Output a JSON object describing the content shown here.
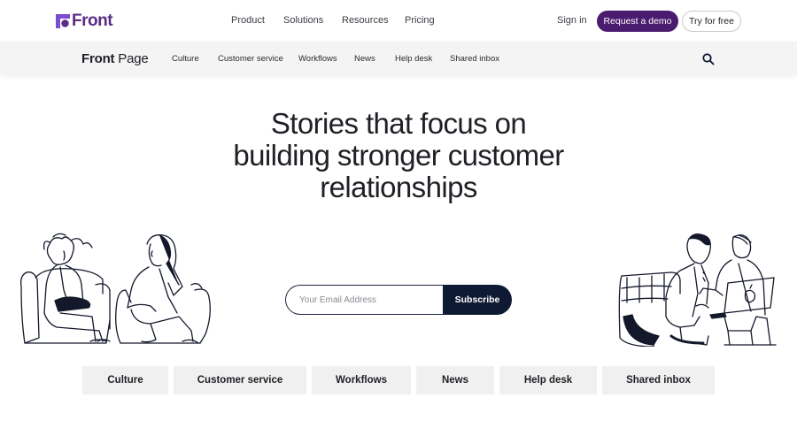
{
  "brand": {
    "name": "Front",
    "color": "#5b2b86"
  },
  "main_nav": [
    "Product",
    "Solutions",
    "Resources",
    "Pricing"
  ],
  "auth": {
    "sign_in": "Sign in",
    "demo": "Request a demo",
    "free": "Try for free",
    "demo_color": "#4a1b6f"
  },
  "subnav": {
    "logo_bold": "Front",
    "logo_regular": " Page",
    "items": [
      "Culture",
      "Customer service",
      "Workflows",
      "News",
      "Help desk",
      "Shared inbox"
    ],
    "search_icon": "search-icon"
  },
  "hero": {
    "title": "Stories that focus on building stronger customer relationships",
    "email_placeholder": "Your Email Address",
    "subscribe": "Subscribe",
    "button_color": "#0e1a33"
  },
  "tiles": [
    "Culture",
    "Customer service",
    "Workflows",
    "News",
    "Help desk",
    "Shared inbox"
  ]
}
